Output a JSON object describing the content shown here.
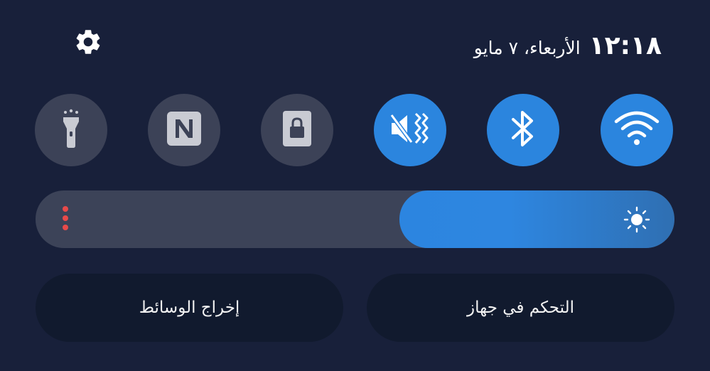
{
  "header": {
    "time": "١٢:١٨",
    "date": "الأربعاء، ٧ مايو"
  },
  "icons": {
    "settings": "gear-icon",
    "flashlight": "flashlight-icon",
    "nfc": "nfc-icon",
    "lock": "screen-lock-icon",
    "mute": "mute-vibrate-icon",
    "bluetooth": "bluetooth-icon",
    "wifi": "wifi-icon",
    "brightness": "sun-icon"
  },
  "quick_tiles": [
    {
      "name": "flashlight",
      "active": false
    },
    {
      "name": "nfc",
      "active": false
    },
    {
      "name": "screen-lock",
      "active": false
    },
    {
      "name": "sound-mode",
      "active": true
    },
    {
      "name": "bluetooth",
      "active": true
    },
    {
      "name": "wifi",
      "active": true
    }
  ],
  "brightness": {
    "level": 0.43
  },
  "buttons": {
    "media_output": "إخراج الوسائط",
    "device_control": "التحكم في جهاز"
  },
  "colors": {
    "background": "#18203a",
    "tile_off": "#3c4257",
    "tile_on": "#2b85de",
    "button_bg": "#111a2e",
    "brightness_dots": "#e84a4a"
  }
}
